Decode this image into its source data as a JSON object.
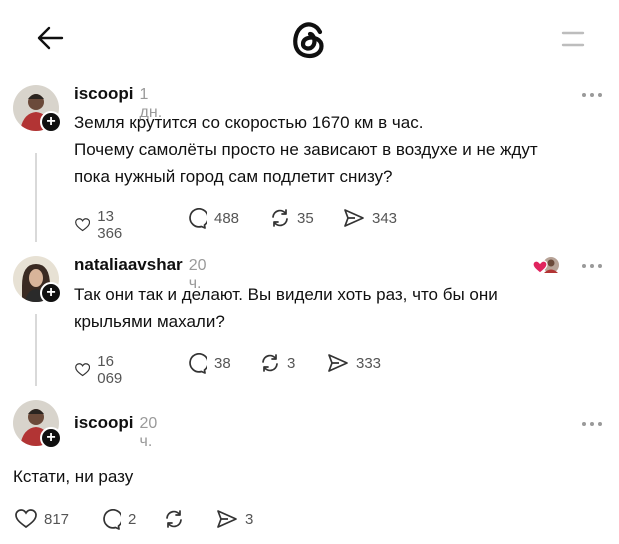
{
  "header": {
    "back_icon": "arrow-left-icon",
    "logo_icon": "threads-logo-icon",
    "menu_icon": "menu-icon"
  },
  "posts": [
    {
      "username": "iscoopi",
      "time": "1 дн.",
      "text_lines": [
        "Земля крутится со скоростью 1670 км в час.",
        "Почему самолёты просто не зависают в воздухе и не ждут",
        "пока нужный город сам подлетит снизу?"
      ],
      "likes": "13 366",
      "comments": "488",
      "reposts": "35",
      "shares": "343"
    },
    {
      "username": "nataliaavshar",
      "time": "20 ч.",
      "text_lines": [
        "Так они так и делают. Вы видели хоть раз, что бы они",
        "крыльями махали?"
      ],
      "likes": "16 069",
      "comments": "38",
      "reposts": "3",
      "shares": "333"
    },
    {
      "username": "iscoopi",
      "time": "20 ч.",
      "text_lines": [
        "Кстати, ни разу"
      ],
      "likes": "817",
      "comments": "2",
      "reposts": "",
      "shares": "3"
    }
  ],
  "colors": {
    "text": "#101010",
    "muted": "#9a9a9a",
    "line": "#d9d9d9",
    "heart_badge": "#e0245e"
  }
}
